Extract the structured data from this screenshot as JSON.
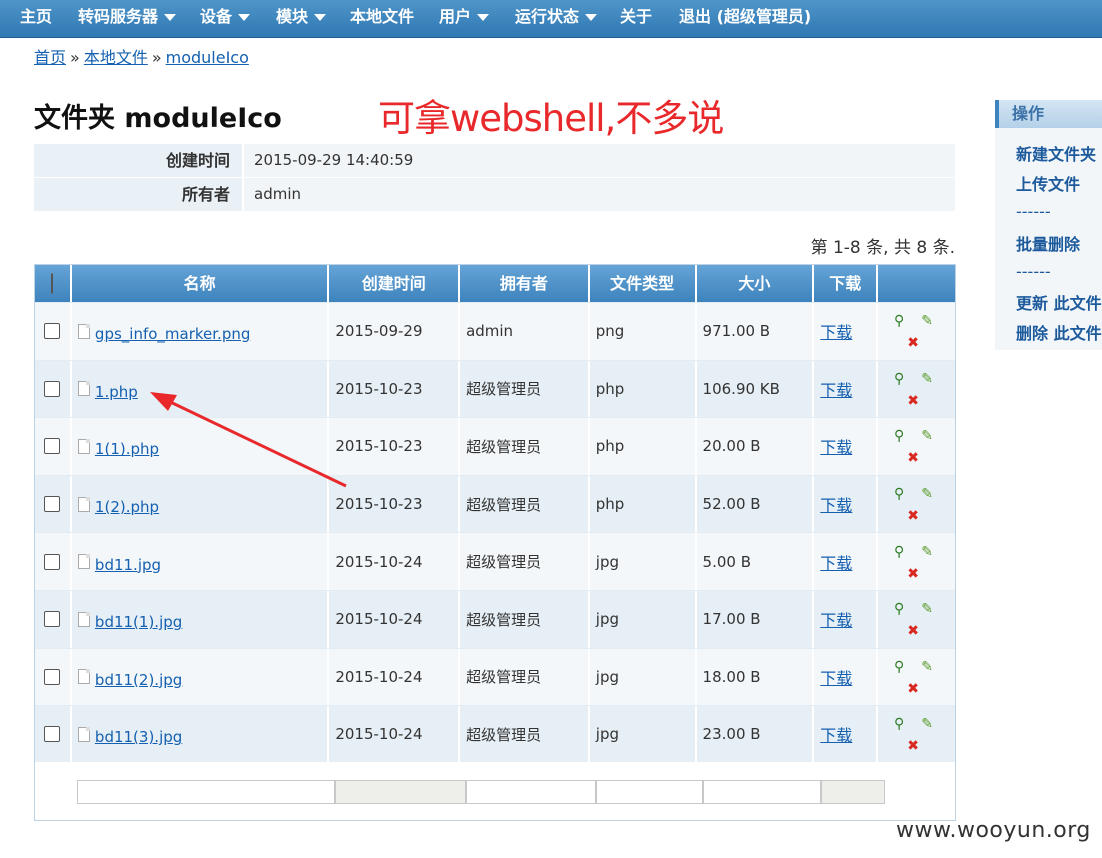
{
  "nav": {
    "items": [
      {
        "label": "主页",
        "dropdown": false
      },
      {
        "label": "转码服务器",
        "dropdown": true
      },
      {
        "label": "设备",
        "dropdown": true
      },
      {
        "label": "模块",
        "dropdown": true
      },
      {
        "label": "本地文件",
        "dropdown": false
      },
      {
        "label": "用户",
        "dropdown": true
      },
      {
        "label": "运行状态",
        "dropdown": true
      },
      {
        "label": "关于",
        "dropdown": false
      },
      {
        "label": "退出 (超级管理员)",
        "dropdown": false
      }
    ]
  },
  "breadcrumb": {
    "home": "首页",
    "local_files": "本地文件",
    "current": "moduleIco",
    "separator": "»"
  },
  "page": {
    "title": "文件夹 moduleIco",
    "annotation": "可拿webshell,不多说"
  },
  "info": {
    "created_label": "创建时间",
    "created_value": "2015-09-29 14:40:59",
    "owner_label": "所有者",
    "owner_value": "admin"
  },
  "count_text": "第 1-8 条, 共 8 条.",
  "table": {
    "headers": [
      "名称",
      "创建时间",
      "拥有者",
      "文件类型",
      "大小",
      "下载"
    ],
    "download_label": "下载",
    "rows": [
      {
        "name": "gps_info_marker.png",
        "date": "2015-09-29",
        "owner": "admin",
        "type": "png",
        "size": "971.00 B"
      },
      {
        "name": "1.php",
        "date": "2015-10-23",
        "owner": "超级管理员",
        "type": "php",
        "size": "106.90 KB"
      },
      {
        "name": "1(1).php",
        "date": "2015-10-23",
        "owner": "超级管理员",
        "type": "php",
        "size": "20.00 B"
      },
      {
        "name": "1(2).php",
        "date": "2015-10-23",
        "owner": "超级管理员",
        "type": "php",
        "size": "52.00 B"
      },
      {
        "name": "bd11.jpg",
        "date": "2015-10-24",
        "owner": "超级管理员",
        "type": "jpg",
        "size": "5.00 B"
      },
      {
        "name": "bd11(1).jpg",
        "date": "2015-10-24",
        "owner": "超级管理员",
        "type": "jpg",
        "size": "17.00 B"
      },
      {
        "name": "bd11(2).jpg",
        "date": "2015-10-24",
        "owner": "超级管理员",
        "type": "jpg",
        "size": "18.00 B"
      },
      {
        "name": "bd11(3).jpg",
        "date": "2015-10-24",
        "owner": "超级管理员",
        "type": "jpg",
        "size": "23.00 B"
      }
    ]
  },
  "sidebar": {
    "title": "操作",
    "items": [
      "新建文件夹",
      "上传文件",
      "------",
      "批量删除",
      "------",
      "更新 此文件",
      "删除 此文件"
    ]
  },
  "watermark": "www.wooyun.org",
  "colors": {
    "nav": "#3a82bd",
    "link": "#1560b0",
    "annotation": "#e8282a",
    "arrow": "#e8282a"
  }
}
